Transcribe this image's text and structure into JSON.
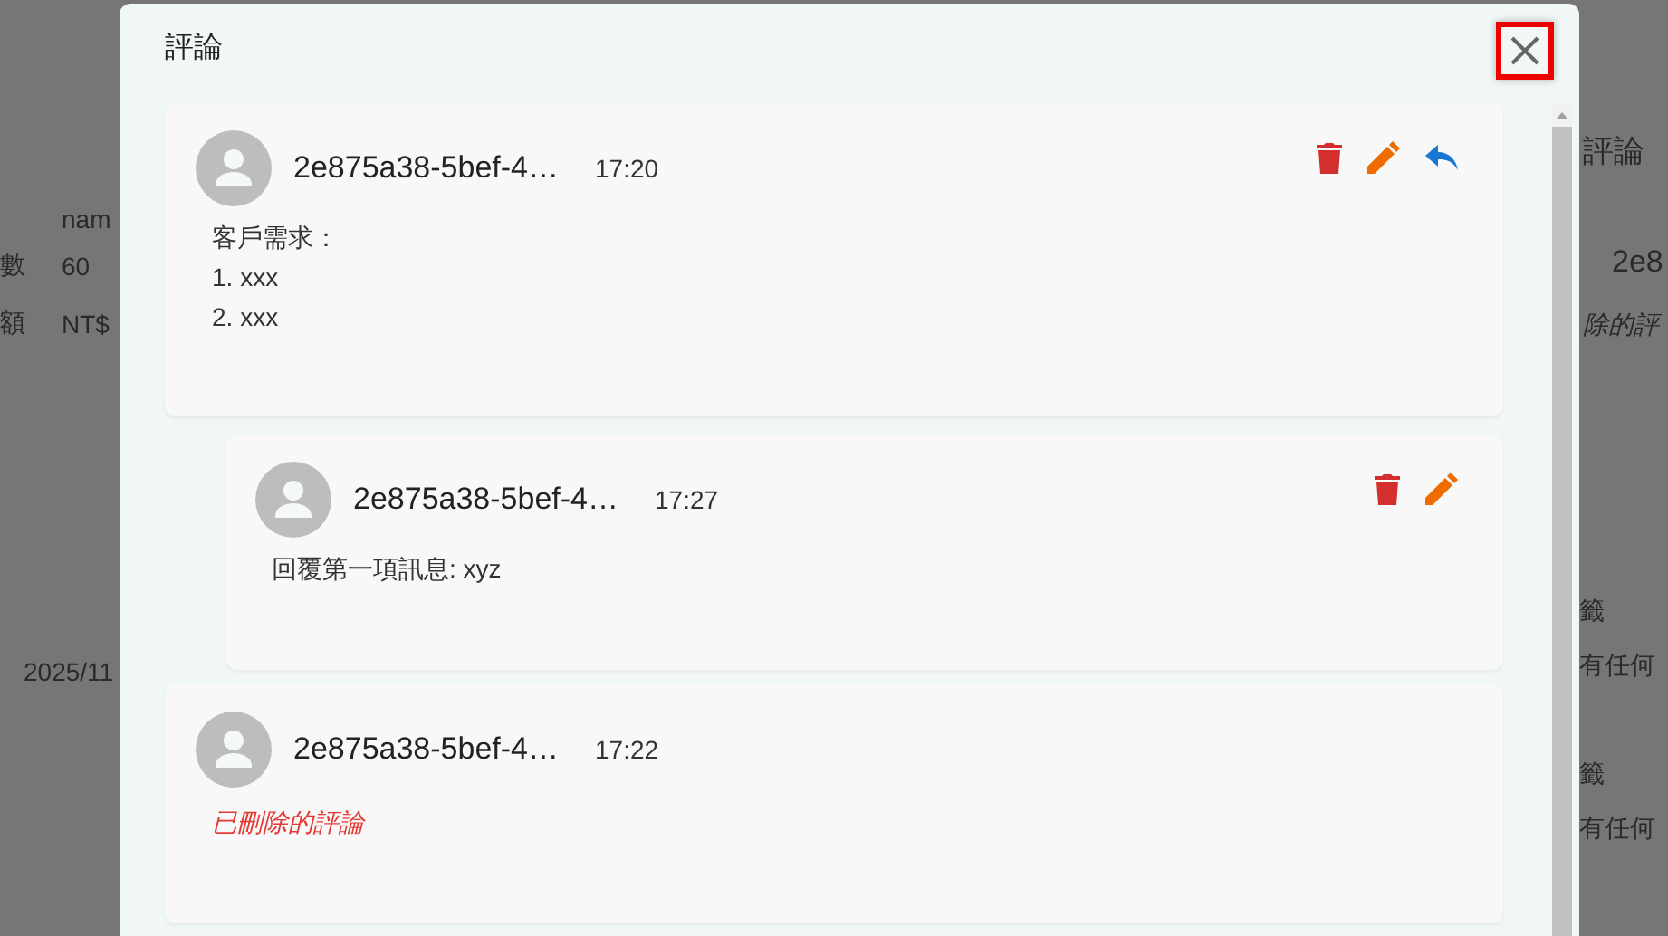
{
  "background_page": {
    "left": [
      {
        "kind": "single",
        "value": "nam"
      },
      {
        "kind": "pair",
        "label": "數",
        "value": "60"
      },
      {
        "kind": "pair",
        "label": "額",
        "value": "NT$"
      },
      {
        "kind": "date",
        "value": "2025/11"
      }
    ],
    "right": [
      {
        "kind": "heading",
        "value": "評論"
      },
      {
        "kind": "author",
        "value": "2e8"
      },
      {
        "kind": "deleted",
        "value": "除的評"
      },
      {
        "kind": "label",
        "value": "籤"
      },
      {
        "kind": "note",
        "value": "有任何"
      },
      {
        "kind": "label",
        "value": "籤"
      },
      {
        "kind": "note",
        "value": "有任何"
      }
    ]
  },
  "dialog": {
    "title": "評論",
    "comments": [
      {
        "author": "2e875a38-5bef-4…",
        "time": "17:20",
        "deleted": false,
        "body": [
          "客戶需求：",
          "1. xxx",
          "2. xxx"
        ],
        "can_delete": true,
        "can_edit": true,
        "can_reply": true,
        "replies": [
          {
            "author": "2e875a38-5bef-4…",
            "time": "17:27",
            "deleted": false,
            "body": [
              "回覆第一項訊息: xyz"
            ],
            "can_delete": true,
            "can_edit": true,
            "can_reply": false
          }
        ]
      },
      {
        "author": "2e875a38-5bef-4…",
        "time": "17:22",
        "deleted": true,
        "body": [
          "已刪除的評論"
        ],
        "can_delete": false,
        "can_edit": false,
        "can_reply": false
      }
    ]
  }
}
